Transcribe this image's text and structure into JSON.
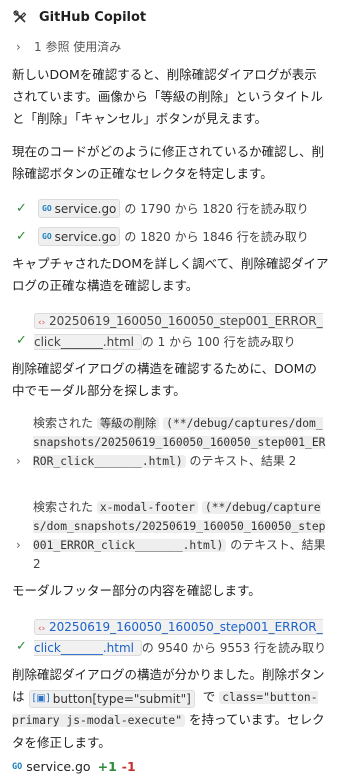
{
  "header": {
    "title": "GitHub Copilot"
  },
  "refs": {
    "label": "1 参照 使用済み"
  },
  "para1": "新しいDOMを確認すると、削除確認ダイアログが表示されています。画像から「等級の削除」というタイトルと「削除」「キャンセル」ボタンが見えます。",
  "para2": "現在のコードがどのように修正されているか確認し、削除確認ボタンの正確なセレクタを特定します。",
  "tool1": {
    "file": "service.go",
    "text": "の 1790 から 1820 行を読み取り"
  },
  "tool2": {
    "file": "service.go",
    "text": "の 1820 から 1846 行を読み取り"
  },
  "para3": "キャプチャされたDOMを詳しく調べて、削除確認ダイアログの正確な構造を確認します。",
  "tool3": {
    "file": "20250619_160050_160050_step001_ERROR_click_______.html",
    "text": "の 1 から 100 行を読み取り"
  },
  "para4": "削除確認ダイアログの構造を確認するために、DOMの中でモーダル部分を探します。",
  "search1": {
    "prefix": "検索された",
    "term": "等級の削除",
    "path": "(**/debug/captures/dom_snapshots/20250619_160050_160050_step001_ERROR_click_______.html)",
    "suffix": "のテキスト、結果 2"
  },
  "search2": {
    "prefix": "検索された",
    "term": "x-modal-footer",
    "path": "(**/debug/captures/dom_snapshots/20250619_160050_160050_step001_ERROR_click_______.html)",
    "suffix": "のテキスト、結果 2"
  },
  "para5": "モーダルフッター部分の内容を確認します。",
  "tool4": {
    "file": "20250619_160050_160050_step001_ERROR_click_______.html",
    "text": "の 9540 から 9553 行を読み取り"
  },
  "para6": {
    "a": "削除確認ダイアログの構造が分かりました。削除ボタンは",
    "selector": "button[type=\"submit\"]",
    "b": "で",
    "cls": "class=\"button-primary js-modal-execute\"",
    "c": "を持っています。セレクタを修正します。"
  },
  "footer": {
    "file": "service.go",
    "plus": "+1",
    "minus": "-1"
  }
}
